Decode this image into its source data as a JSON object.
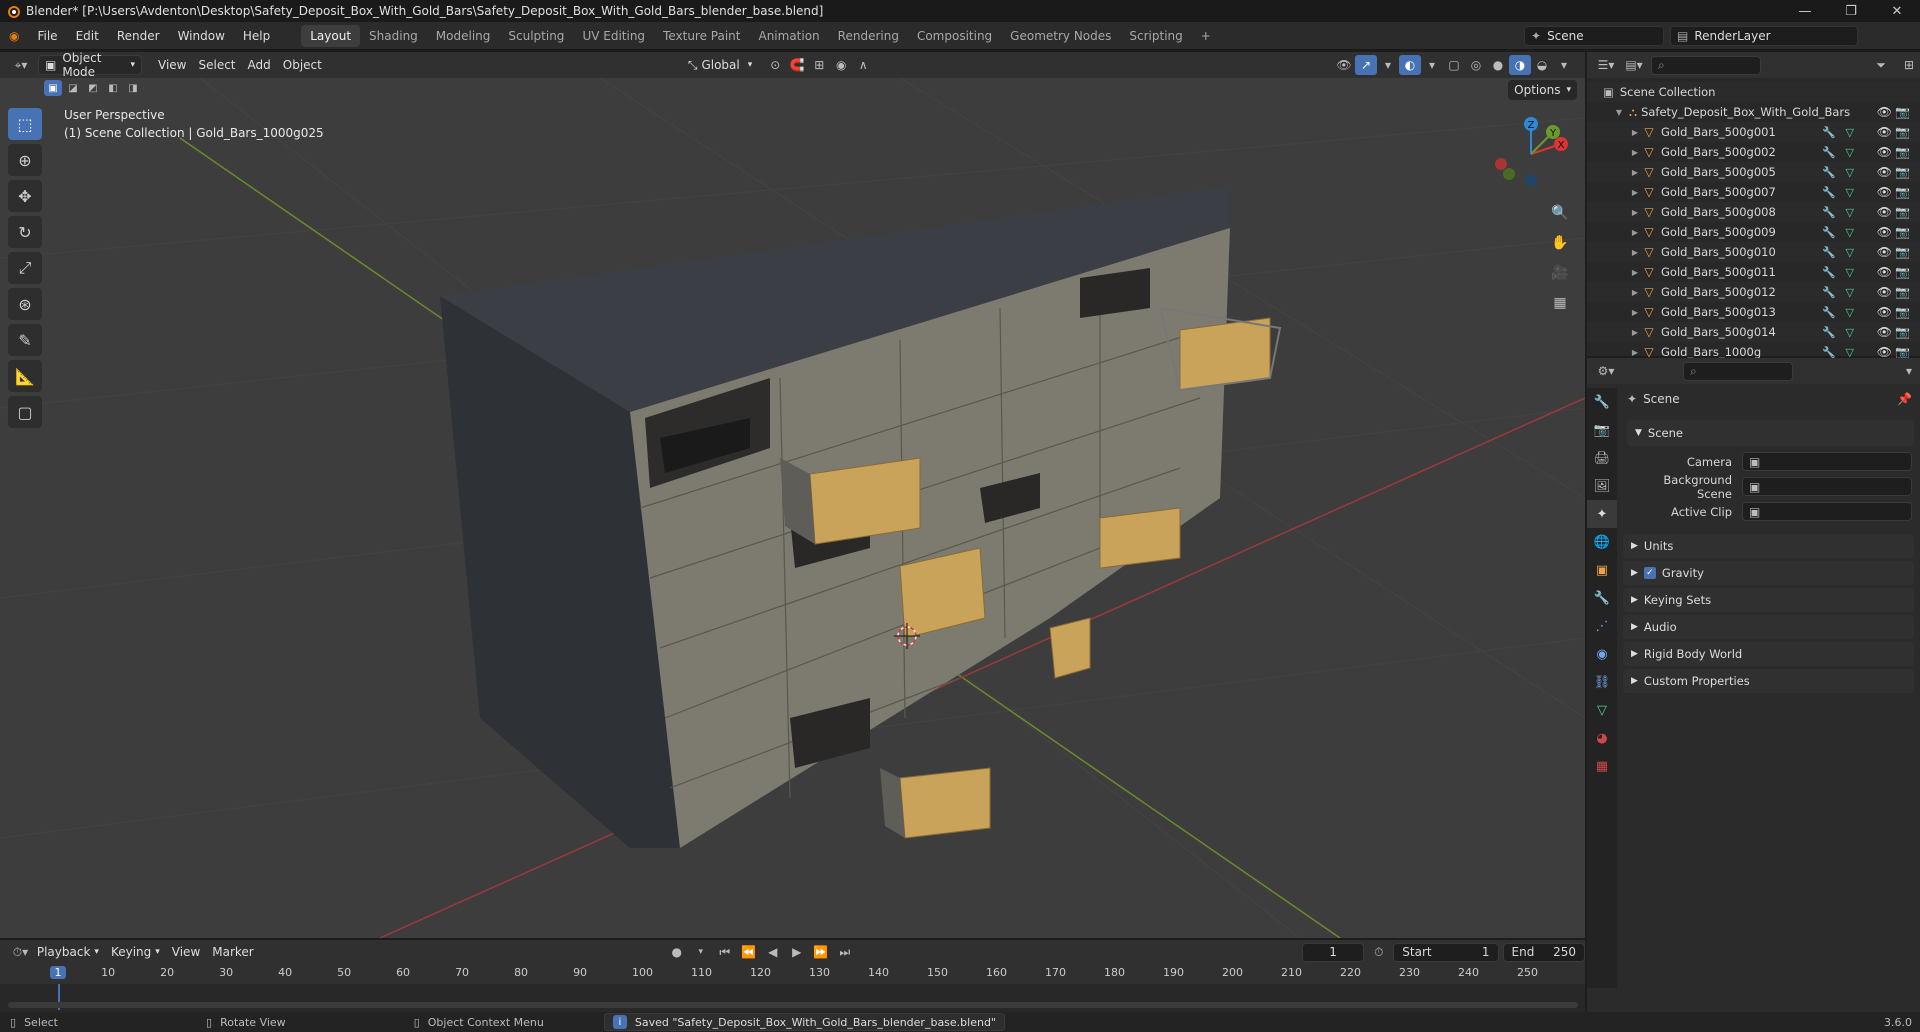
{
  "window": {
    "title": "Blender* [P:\\Users\\Avdenton\\Desktop\\Safety_Deposit_Box_With_Gold_Bars\\Safety_Deposit_Box_With_Gold_Bars_blender_base.blend]"
  },
  "menu": [
    "File",
    "Edit",
    "Render",
    "Window",
    "Help"
  ],
  "workspaces": [
    "Layout",
    "Shading",
    "Modeling",
    "Sculpting",
    "UV Editing",
    "Texture Paint",
    "Animation",
    "Rendering",
    "Compositing",
    "Geometry Nodes",
    "Scripting"
  ],
  "active_workspace": "Layout",
  "scene_name": "Scene",
  "view_layer": "RenderLayer",
  "viewport_header": {
    "mode": "Object Mode",
    "menus": [
      "View",
      "Select",
      "Add",
      "Object"
    ],
    "orientation": "Global",
    "options": "Options"
  },
  "viewport_overlay": {
    "perspective": "User Perspective",
    "context": "(1) Scene Collection | Gold_Bars_1000g025"
  },
  "gizmo": {
    "x": "X",
    "y": "Y",
    "z": "Z"
  },
  "outliner": {
    "root": "Scene Collection",
    "collection": "Safety_Deposit_Box_With_Gold_Bars",
    "items": [
      "Gold_Bars_500g001",
      "Gold_Bars_500g002",
      "Gold_Bars_500g005",
      "Gold_Bars_500g007",
      "Gold_Bars_500g008",
      "Gold_Bars_500g009",
      "Gold_Bars_500g010",
      "Gold_Bars_500g011",
      "Gold_Bars_500g012",
      "Gold_Bars_500g013",
      "Gold_Bars_500g014",
      "Gold_Bars_1000g"
    ]
  },
  "properties": {
    "header": "Scene",
    "section": "Scene",
    "fields": [
      {
        "label": "Camera",
        "value": ""
      },
      {
        "label": "Background Scene",
        "value": ""
      },
      {
        "label": "Active Clip",
        "value": ""
      }
    ],
    "panels": [
      "Units",
      "Gravity",
      "Keying Sets",
      "Audio",
      "Rigid Body World",
      "Custom Properties"
    ],
    "gravity_checked": true
  },
  "timeline": {
    "menus": [
      "Playback",
      "Keying",
      "View",
      "Marker"
    ],
    "current_frame": "1",
    "start_label": "Start",
    "start": "1",
    "end_label": "End",
    "end": "250",
    "ticks": [
      "1",
      "10",
      "20",
      "30",
      "40",
      "50",
      "60",
      "70",
      "80",
      "90",
      "100",
      "110",
      "120",
      "130",
      "140",
      "150",
      "160",
      "170",
      "180",
      "190",
      "200",
      "210",
      "220",
      "230",
      "240",
      "250"
    ]
  },
  "statusbar": {
    "select": "Select",
    "rotate": "Rotate View",
    "context_menu": "Object Context Menu",
    "message": "Saved \"Safety_Deposit_Box_With_Gold_Bars_blender_base.blend\"",
    "version": "3.6.0"
  },
  "colors": {
    "accent": "#4772b3",
    "mesh": "#f0a04b",
    "modifier": "#6fa7e8",
    "data": "#4fd48c",
    "frame": "#4772b3"
  }
}
